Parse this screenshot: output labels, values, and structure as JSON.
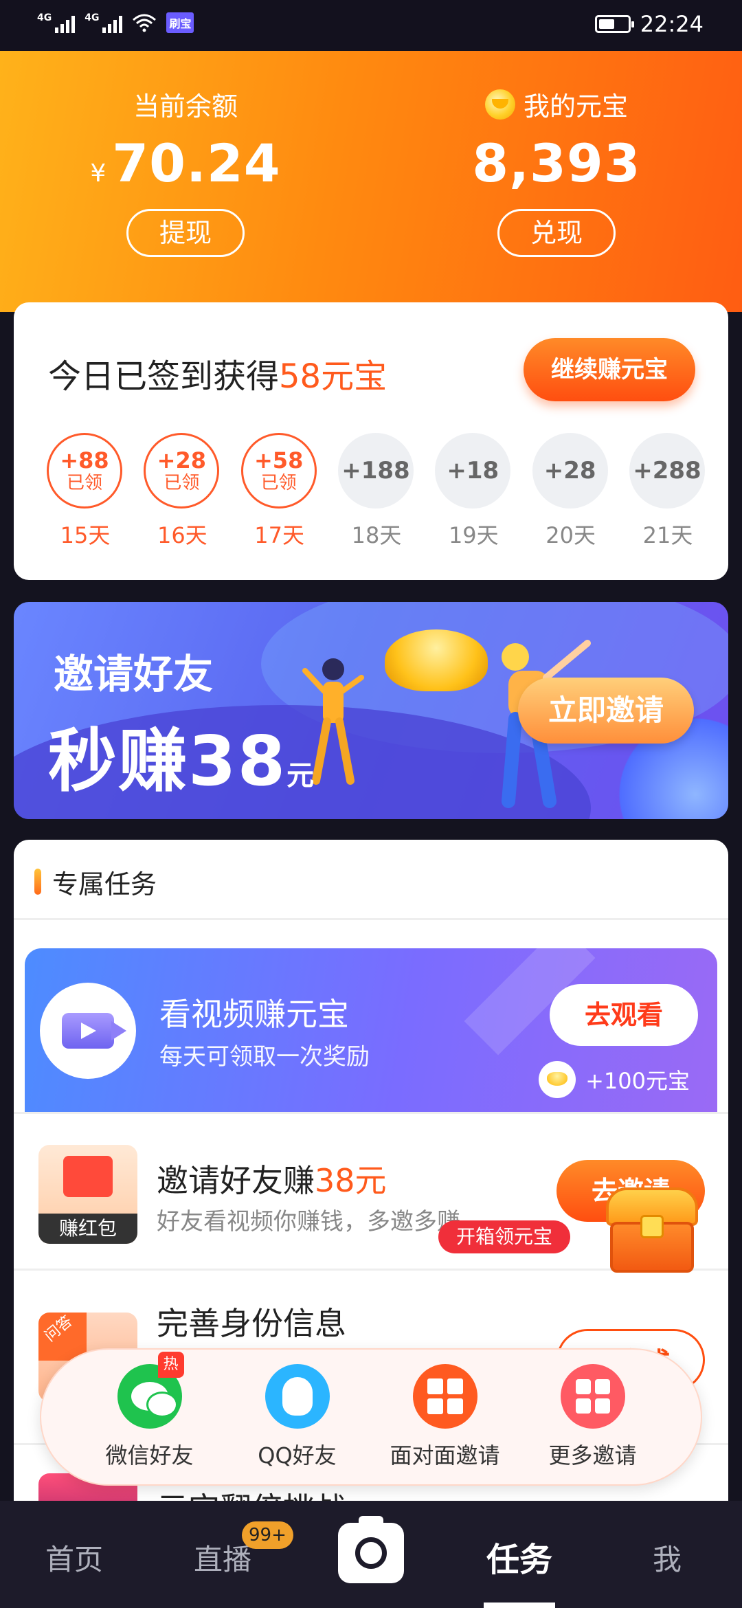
{
  "status_bar": {
    "sig1": "4G",
    "sig2": "4G",
    "app_badge": "刷宝",
    "time": "22:24"
  },
  "header": {
    "balance_label": "当前余额",
    "currency": "¥",
    "balance_value": "70.24",
    "withdraw_label": "提现",
    "yuanbao_label": "我的元宝",
    "yuanbao_value": "8,393",
    "exchange_label": "兑现"
  },
  "signin": {
    "title_prefix": "今日已签到获得",
    "title_highlight": "58元宝",
    "continue_label": "继续赚元宝",
    "days": [
      {
        "amount": "+88",
        "status": "已领",
        "day": "15天",
        "claimed": true
      },
      {
        "amount": "+28",
        "status": "已领",
        "day": "16天",
        "claimed": true
      },
      {
        "amount": "+58",
        "status": "已领",
        "day": "17天",
        "claimed": true
      },
      {
        "amount": "+188",
        "status": "",
        "day": "18天",
        "claimed": false
      },
      {
        "amount": "+18",
        "status": "",
        "day": "19天",
        "claimed": false
      },
      {
        "amount": "+28",
        "status": "",
        "day": "20天",
        "claimed": false
      },
      {
        "amount": "+288",
        "status": "",
        "day": "21天",
        "claimed": false
      }
    ]
  },
  "invite_banner": {
    "title": "邀请好友",
    "big_prefix": "秒赚",
    "big_number": "38",
    "unit": "元",
    "button": "立即邀请"
  },
  "tasks": {
    "section_title": "专属任务",
    "video_task": {
      "title": "看视频赚元宝",
      "subtitle": "每天可领取一次奖励",
      "button": "去观看",
      "reward": "+100元宝"
    },
    "invite_task": {
      "thumb_caption": "赚红包",
      "title_prefix": "邀请好友赚",
      "title_highlight": "38元",
      "subtitle": "好友看视频你赚钱，多邀多赚",
      "button": "去邀请",
      "treasure_tag": "开箱领元宝"
    },
    "identity_task": {
      "thumb_corner": "问答",
      "title": "完善身份信息",
      "button": "去完成"
    },
    "last_task": {
      "title": "元宝翻倍挑战"
    }
  },
  "share_popup": {
    "items": [
      {
        "label": "微信好友",
        "icon": "wechat-icon",
        "hot": "热"
      },
      {
        "label": "QQ好友",
        "icon": "qq-icon"
      },
      {
        "label": "面对面邀请",
        "icon": "qr-code-icon"
      },
      {
        "label": "更多邀请",
        "icon": "more-grid-icon"
      }
    ]
  },
  "bottom_nav": {
    "home": "首页",
    "live": "直播",
    "live_badge": "99+",
    "tasks": "任务",
    "me": "我"
  },
  "colors": {
    "accent_orange": "#ff5a1c",
    "header_gradient_start": "#ffb21a",
    "header_gradient_end": "#ff5d12",
    "banner_blue": "#5a66f0"
  }
}
